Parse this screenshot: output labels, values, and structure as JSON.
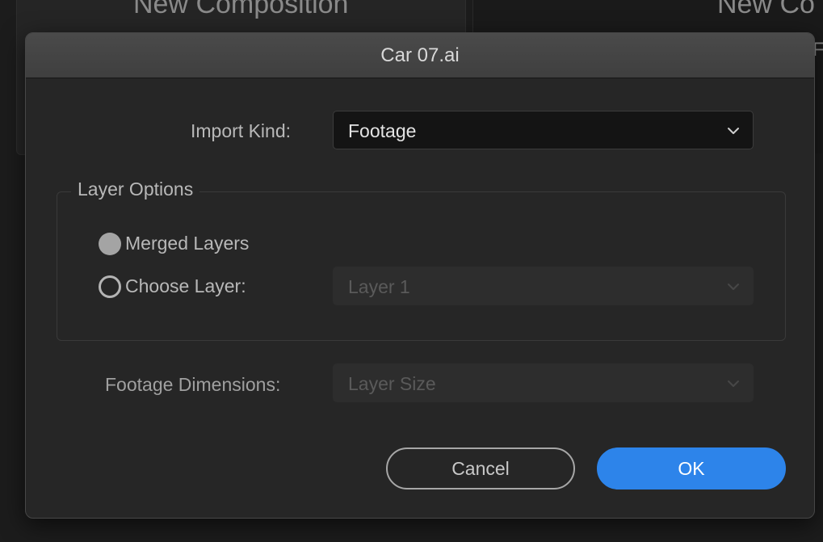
{
  "background": {
    "left_title": "New Composition",
    "right_title": "New Co",
    "right_edge_char": "F"
  },
  "dialog": {
    "title": "Car 07.ai",
    "import_kind": {
      "label": "Import Kind:",
      "value": "Footage",
      "icon": "chevron-down-icon"
    },
    "layer_options": {
      "legend": "Layer Options",
      "merged_layers": {
        "label": "Merged Layers",
        "selected": true
      },
      "choose_layer": {
        "label": "Choose Layer:",
        "selected": false,
        "value": "Layer 1"
      }
    },
    "footage_dimensions": {
      "label": "Footage Dimensions:",
      "value": "Layer Size"
    },
    "buttons": {
      "cancel": "Cancel",
      "ok": "OK"
    }
  },
  "colors": {
    "accent": "#2d84ea",
    "dialog_bg": "#262626",
    "titlebar_bg": "#444444"
  }
}
